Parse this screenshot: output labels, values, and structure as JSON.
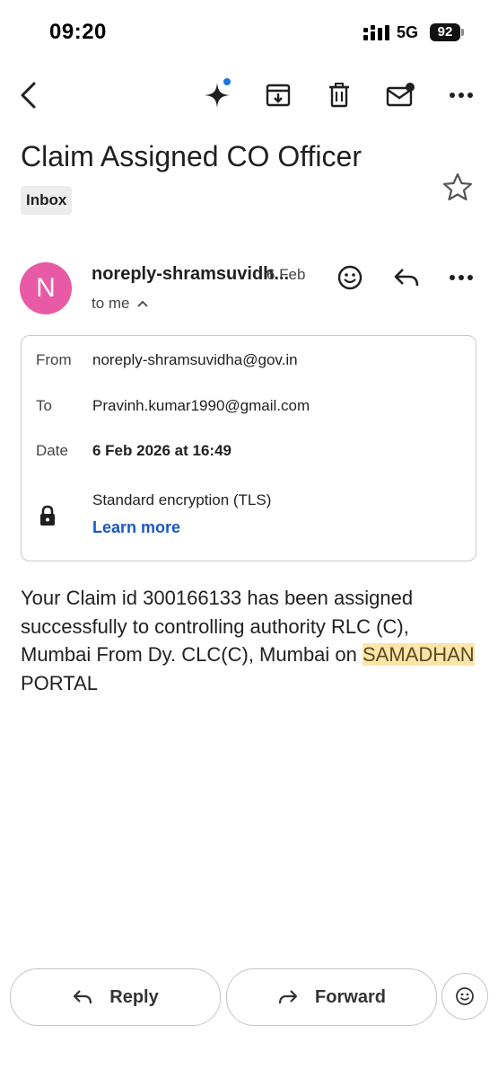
{
  "status_bar": {
    "time": "09:20",
    "network": "5G",
    "battery": "92"
  },
  "toolbar": {
    "back_icon": "back-arrow-icon",
    "gemini_icon": "sparkle-icon",
    "archive_icon": "archive-icon",
    "delete_icon": "trash-icon",
    "unread_icon": "mark-unread-icon",
    "more_icon": "more-horizontal-icon"
  },
  "email": {
    "subject": "Claim Assigned CO Officer",
    "label": "Inbox",
    "sender_initial": "N",
    "sender_short": "noreply-shramsuvidh...",
    "date_short": "6 Feb",
    "to_me": "to me",
    "details": {
      "from_label": "From",
      "from_value": "noreply-shramsuvidha@gov.in",
      "to_label": "To",
      "to_value": "Pravinh.kumar1990@gmail.com",
      "date_label": "Date",
      "date_value": "6 Feb 2026 at 16:49",
      "encryption": "Standard encryption (TLS)",
      "learn_more": "Learn more"
    },
    "body_before": "Your Claim id 300166133 has been assigned successfully to controlling authority RLC (C), Mumbai From Dy. CLC(C), Mumbai on ",
    "body_highlight": "SAMADHAN",
    "body_after": " PORTAL"
  },
  "actions": {
    "reply": "Reply",
    "forward": "Forward"
  },
  "colors": {
    "avatar": "#e85aa5",
    "link": "#1a57c8",
    "highlight": "#fde4a8",
    "gemini_dot": "#1a73e8"
  }
}
